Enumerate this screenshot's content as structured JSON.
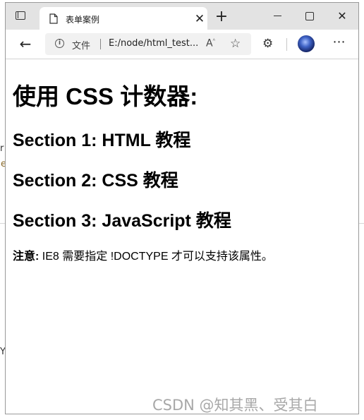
{
  "tab": {
    "title": "表单案例"
  },
  "address_bar": {
    "scheme_label": "文件",
    "url": "E:/node/html_test...",
    "read_aloud": "Aᴬ"
  },
  "page": {
    "heading": "使用 CSS 计数器:",
    "sections": [
      "Section 1: HTML 教程",
      "Section 2: CSS 教程",
      "Section 3: JavaScript 教程"
    ],
    "note_label": "注意:",
    "note_text": " IE8 需要指定 !DOCTYPE 才可以支持该属性。"
  },
  "background_fragments": {
    "left_1": "r",
    "left_2": "e",
    "left_3": "Y"
  },
  "watermark": "CSDN @知其黑、受其白",
  "icons": {
    "tab_actions": "tab-actions-icon",
    "page": "page-icon",
    "close_tab": "close-icon",
    "new_tab": "plus-icon",
    "back": "back-arrow-icon",
    "info": "info-icon",
    "read_aloud": "read-aloud-icon",
    "favorites": "favorite-add-icon",
    "extensions": "puzzle-icon",
    "profile": "avatar",
    "more": "more-icon"
  }
}
